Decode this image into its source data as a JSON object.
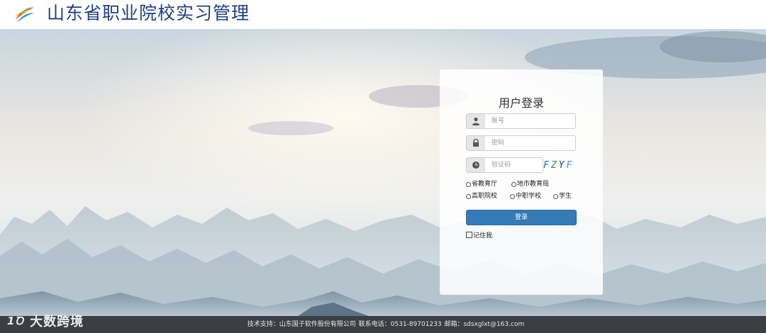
{
  "header": {
    "title": "山东省职业院校实习管理",
    "logo_icon": "colorful-leaf-logo"
  },
  "login": {
    "title": "用户登录",
    "account_placeholder": "账号",
    "password_placeholder": "密码",
    "captcha_placeholder": "验证码",
    "captcha_text": "FZYF",
    "captcha_colors": [
      "#1f6fb5",
      "#2f8f5b",
      "#2d2d8a",
      "#2aa0a8"
    ],
    "roles_row1": [
      "省教育厅",
      "地市教育局"
    ],
    "roles_row2": [
      "高职院校",
      "中职学校",
      "学生"
    ],
    "login_button": "登录",
    "remember_label": "记住我",
    "icons": {
      "account": "user-icon",
      "password": "lock-icon",
      "captcha": "clock-icon"
    }
  },
  "footer": {
    "text": "技术支持：山东国子软件股份有限公司   联系电话：0531-89701233   邮箱：sdsxglxt@163.com"
  },
  "watermark": {
    "mark": "1Ꝺ",
    "text": "大数跨境"
  },
  "colors": {
    "title": "#1e3f86",
    "button": "#337ab7",
    "footer": "#3b3f44"
  }
}
